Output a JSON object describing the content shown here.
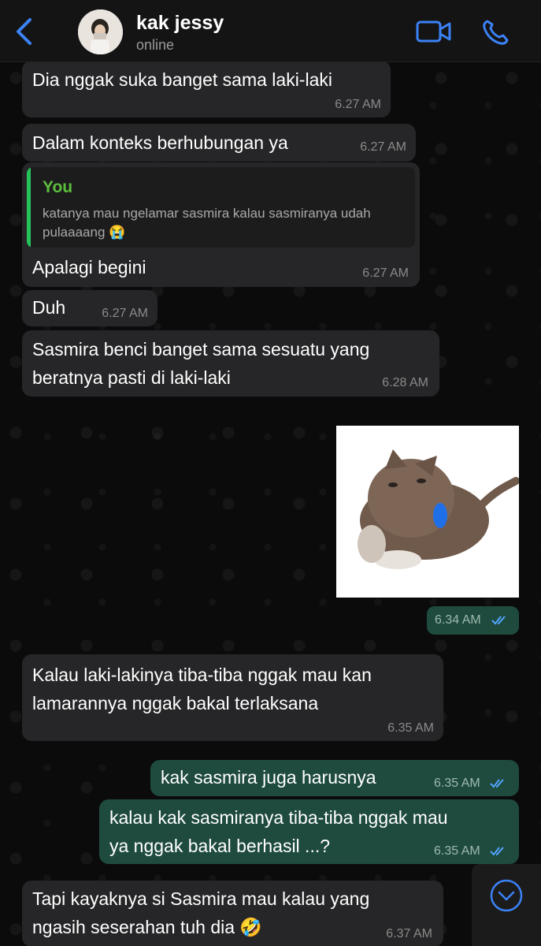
{
  "header": {
    "back_label": "back",
    "contact_name": "kak jessy",
    "status": "online",
    "icons": [
      "back-icon",
      "video-call-icon",
      "phone-icon"
    ]
  },
  "messages": [
    {
      "direction": "in",
      "text": "Dia nggak suka banget sama laki-laki",
      "time": "6.27 AM"
    },
    {
      "direction": "in",
      "text": "Dalam konteks berhubungan ya",
      "time": "6.27 AM"
    },
    {
      "direction": "in",
      "quote_author": "You",
      "quote_text": "katanya mau ngelamar sasmira kalau sasmiranya udah pulaaaang 😭",
      "text": "Apalagi begini",
      "time": "6.27 AM"
    },
    {
      "direction": "in",
      "text": "Duh",
      "time": "6.27 AM"
    },
    {
      "direction": "in",
      "text": "Sasmira benci banget sama sesuatu yang\nberatnya pasti di laki-laki",
      "time": "6.28 AM"
    },
    {
      "direction": "out",
      "type": "sticker",
      "sticker": "crying-kitten-sticker",
      "time": "6.34 AM",
      "read": true
    },
    {
      "direction": "in",
      "text": "Kalau laki-lakinya tiba-tiba nggak mau kan\nlamarannya nggak bakal terlaksana",
      "time": "6.35 AM"
    },
    {
      "direction": "out",
      "text": "kak sasmira juga harusnya",
      "time": "6.35 AM",
      "read": true
    },
    {
      "direction": "out",
      "text": "kalau kak sasmiranya tiba-tiba nggak mau\nya nggak bakal berhasil ...?",
      "time": "6.35 AM",
      "read": true
    },
    {
      "direction": "in",
      "text": "Tapi kayaknya si Sasmira mau kalau yang\nngasih seserahan tuh dia 🤣",
      "time": "6.37 AM"
    }
  ],
  "colors": {
    "background": "#0b0b0c",
    "incoming_bubble": "#262628",
    "outgoing_bubble": "#1f4b3f",
    "accent_blue": "#3b82f6",
    "read_tick": "#53a6ff",
    "quote_author": "#5cbf3c"
  }
}
